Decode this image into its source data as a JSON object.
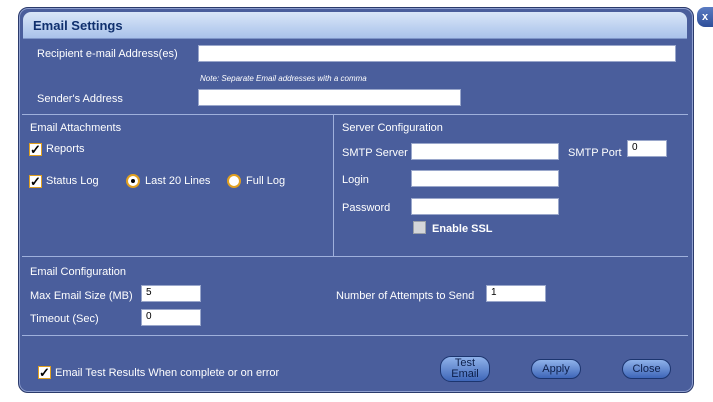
{
  "dialog": {
    "title": "Email Settings",
    "close_label": "x"
  },
  "recipients": {
    "label": "Recipient e-mail Address(es)",
    "value": "",
    "note": "Note: Separate Email addresses with a comma"
  },
  "sender": {
    "label": "Sender's Address",
    "value": ""
  },
  "attachments": {
    "heading": "Email Attachments",
    "reports": {
      "label": "Reports",
      "checked": true
    },
    "status_log": {
      "label": "Status Log",
      "checked": true
    },
    "last20": {
      "label": "Last 20 Lines",
      "selected": true
    },
    "full_log": {
      "label": "Full Log",
      "selected": false
    }
  },
  "server": {
    "heading": "Server Configuration",
    "smtp_server_label": "SMTP Server",
    "smtp_server_value": "",
    "smtp_port_label": "SMTP Port",
    "smtp_port_value": "0",
    "login_label": "Login",
    "login_value": "",
    "password_label": "Password",
    "password_value": "",
    "ssl_label": "Enable SSL",
    "ssl_checked": false
  },
  "config": {
    "heading": "Email Configuration",
    "max_size_label": "Max Email Size (MB)",
    "max_size_value": "5",
    "timeout_label": "Timeout (Sec)",
    "timeout_value": "0",
    "attempts_label": "Number of Attempts to Send",
    "attempts_value": "1"
  },
  "footer": {
    "test_results_label": "Email Test Results When complete or on error",
    "test_results_checked": true,
    "test_email_line1": "Test",
    "test_email_line2": "Email",
    "apply_label": "Apply",
    "close_label": "Close"
  },
  "colors": {
    "dialog_bg": "#4a5e9c",
    "title_bg": "#c7d8f3",
    "accent": "#e0a020"
  }
}
